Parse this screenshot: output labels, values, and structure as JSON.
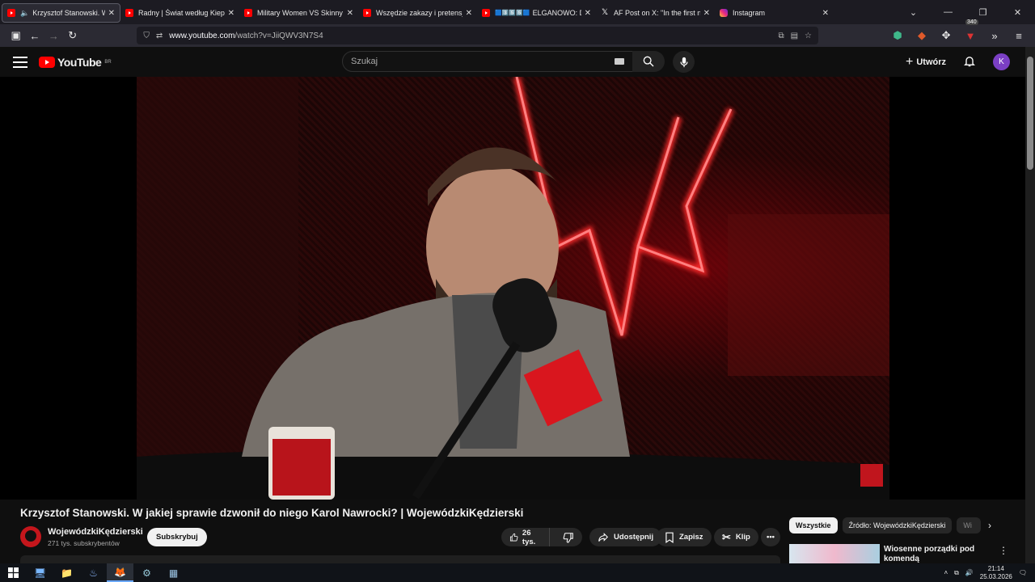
{
  "browser": {
    "tabs": [
      {
        "title": "Krzysztof Stanowski. W jaki",
        "icon": "youtube-icon",
        "audio": true,
        "active": true
      },
      {
        "title": "Radny | Świat według Kiepskich",
        "icon": "youtube-icon"
      },
      {
        "title": "Military Women VS Skinny Joes",
        "icon": "youtube-icon"
      },
      {
        "title": "Wszędzie zakazy i pretensje! Lu",
        "icon": "youtube-icon"
      },
      {
        "title": "ELGANOWO: D",
        "icon": "youtube-icon",
        "emoji_prefix": "🟦3️⃣5️⃣5️⃣🟦"
      },
      {
        "title": "AF Post on X: \"In the first nine n",
        "icon": "x-icon"
      },
      {
        "title": "Instagram",
        "icon": "instagram-icon"
      }
    ],
    "url_host": "www.youtube.com",
    "url_path": "/watch?v=JiiQWV3N7S4",
    "extension_badge": "340"
  },
  "youtube": {
    "logo_text": "YouTube",
    "region": "BR",
    "search_placeholder": "Szukaj",
    "create_label": "Utwórz",
    "avatar_letter": "K"
  },
  "video": {
    "title": "Krzysztof Stanowski. W jakiej sprawie dzwonił do niego Karol Nawrocki? | WojewódzkiKędzierski",
    "channel_name": "WojewódzkiKędzierski",
    "channel_subs": "271 tys. subskrybentów",
    "subscribe_label": "Subskrybuj",
    "likes": "26 tys.",
    "share_label": "Udostępnij",
    "save_label": "Zapisz",
    "clip_label": "Klip"
  },
  "sidebar": {
    "chips": [
      "Wszystkie",
      "Źródło: WojewódzkiKędzierski",
      "Wi"
    ],
    "recommendation_title": "Wiosenne porządki pod komendą"
  },
  "taskbar": {
    "time": "21:14",
    "date": "25.03.2026"
  },
  "colors": {
    "youtube_red": "#ff0000",
    "avatar_purple": "#7b3fc4",
    "neon_red": "#ff2a2a"
  }
}
